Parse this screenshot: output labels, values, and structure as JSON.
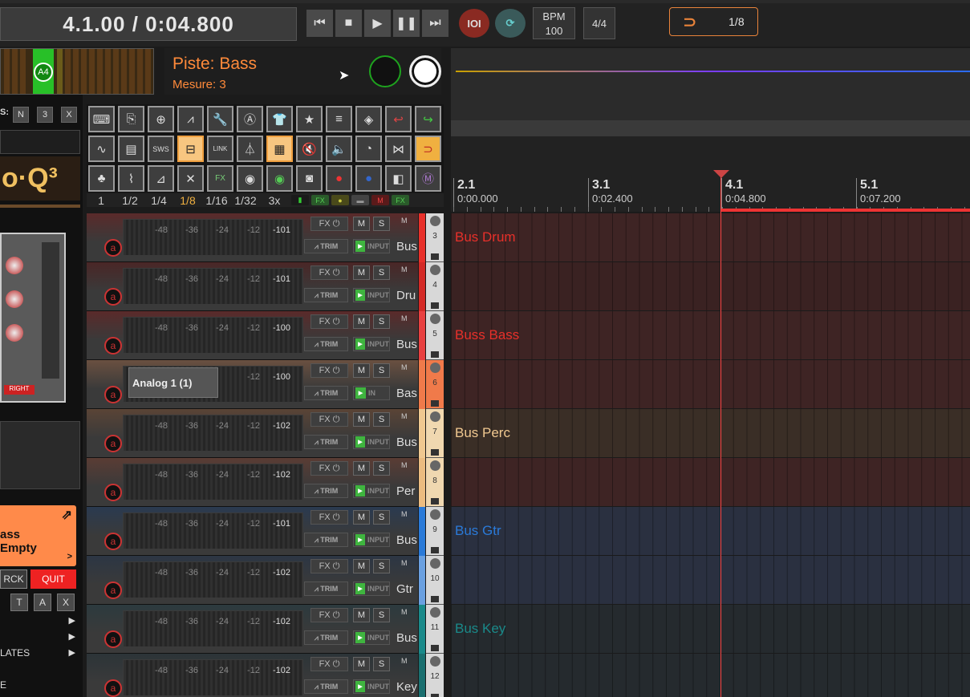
{
  "transport": {
    "position": "4.1.00 / 0:04.800",
    "bpm_label": "BPM",
    "bpm_value": "100",
    "time_signature": "4/4",
    "snap_value": "1/8",
    "record_label": "IOI"
  },
  "track_info": {
    "note": "A4",
    "piste": "Piste:  Bass",
    "mesure": "Mesure: 3"
  },
  "left_panel": {
    "small_buttons": [
      "N",
      "3",
      "X"
    ],
    "eq_logo": "o·Q³",
    "plugin_label_right": "RIGHT",
    "orange_line1": "ass",
    "orange_line2": "Empty",
    "rck_label": "RCK",
    "quit_label": "QUIT",
    "tax_buttons": [
      "T",
      "A",
      "X"
    ],
    "menu_templates": "LATES",
    "menu_e": "E"
  },
  "toolbar": {
    "link_label": "LINK",
    "fx_label": "FX",
    "grid_items": [
      "1",
      "1/2",
      "1/4",
      "1/8",
      "1/16",
      "1/32",
      "3x"
    ],
    "grid_active": "1/8",
    "grid_tags": [
      "FX",
      "FX"
    ]
  },
  "tcp_labels": {
    "fx": "FX",
    "m": "M",
    "s": "S",
    "trim": "TRIM",
    "input": "INPUT",
    "in": "IN",
    "scale": [
      "-48",
      "-36",
      "-24",
      "-12"
    ]
  },
  "tracks": [
    {
      "num": "3",
      "name": "Bus",
      "vol": "-101",
      "lane_label": "Bus Drum",
      "lane_color": "#e8302a"
    },
    {
      "num": "4",
      "name": "Dru",
      "vol": "-101",
      "lane_label": "",
      "lane_color": ""
    },
    {
      "num": "5",
      "name": "Bus",
      "vol": "-100",
      "lane_label": "Buss Bass",
      "lane_color": "#e8302a"
    },
    {
      "num": "6",
      "name": "Bas",
      "vol": "-100",
      "lane_label": "",
      "lane_color": "",
      "plugin_name": "Analog 1 (1)"
    },
    {
      "num": "7",
      "name": "Bus",
      "vol": "-102",
      "lane_label": "Bus Perc",
      "lane_color": "#f0c890"
    },
    {
      "num": "8",
      "name": "Per",
      "vol": "-102",
      "lane_label": "",
      "lane_color": ""
    },
    {
      "num": "9",
      "name": "Bus",
      "vol": "-101",
      "lane_label": "Bus Gtr",
      "lane_color": "#2a7ad8"
    },
    {
      "num": "10",
      "name": "Gtr",
      "vol": "-102",
      "lane_label": "",
      "lane_color": ""
    },
    {
      "num": "11",
      "name": "Bus",
      "vol": "-102",
      "lane_label": "Bus Key",
      "lane_color": "#1a8a8a"
    },
    {
      "num": "12",
      "name": "Key",
      "vol": "-102",
      "lane_label": "",
      "lane_color": ""
    }
  ],
  "ruler": [
    {
      "bar": "2.1",
      "time": "0:00.000"
    },
    {
      "bar": "3.1",
      "time": "0:02.400"
    },
    {
      "bar": "4.1",
      "time": "0:04.800"
    },
    {
      "bar": "5.1",
      "time": "0:07.200"
    }
  ],
  "colors": {
    "accent_orange": "#e8833a",
    "drum_red": "#e8302a",
    "perc_tan": "#f0c890",
    "gtr_blue": "#2a7ad8",
    "key_teal": "#1a8a8a"
  }
}
